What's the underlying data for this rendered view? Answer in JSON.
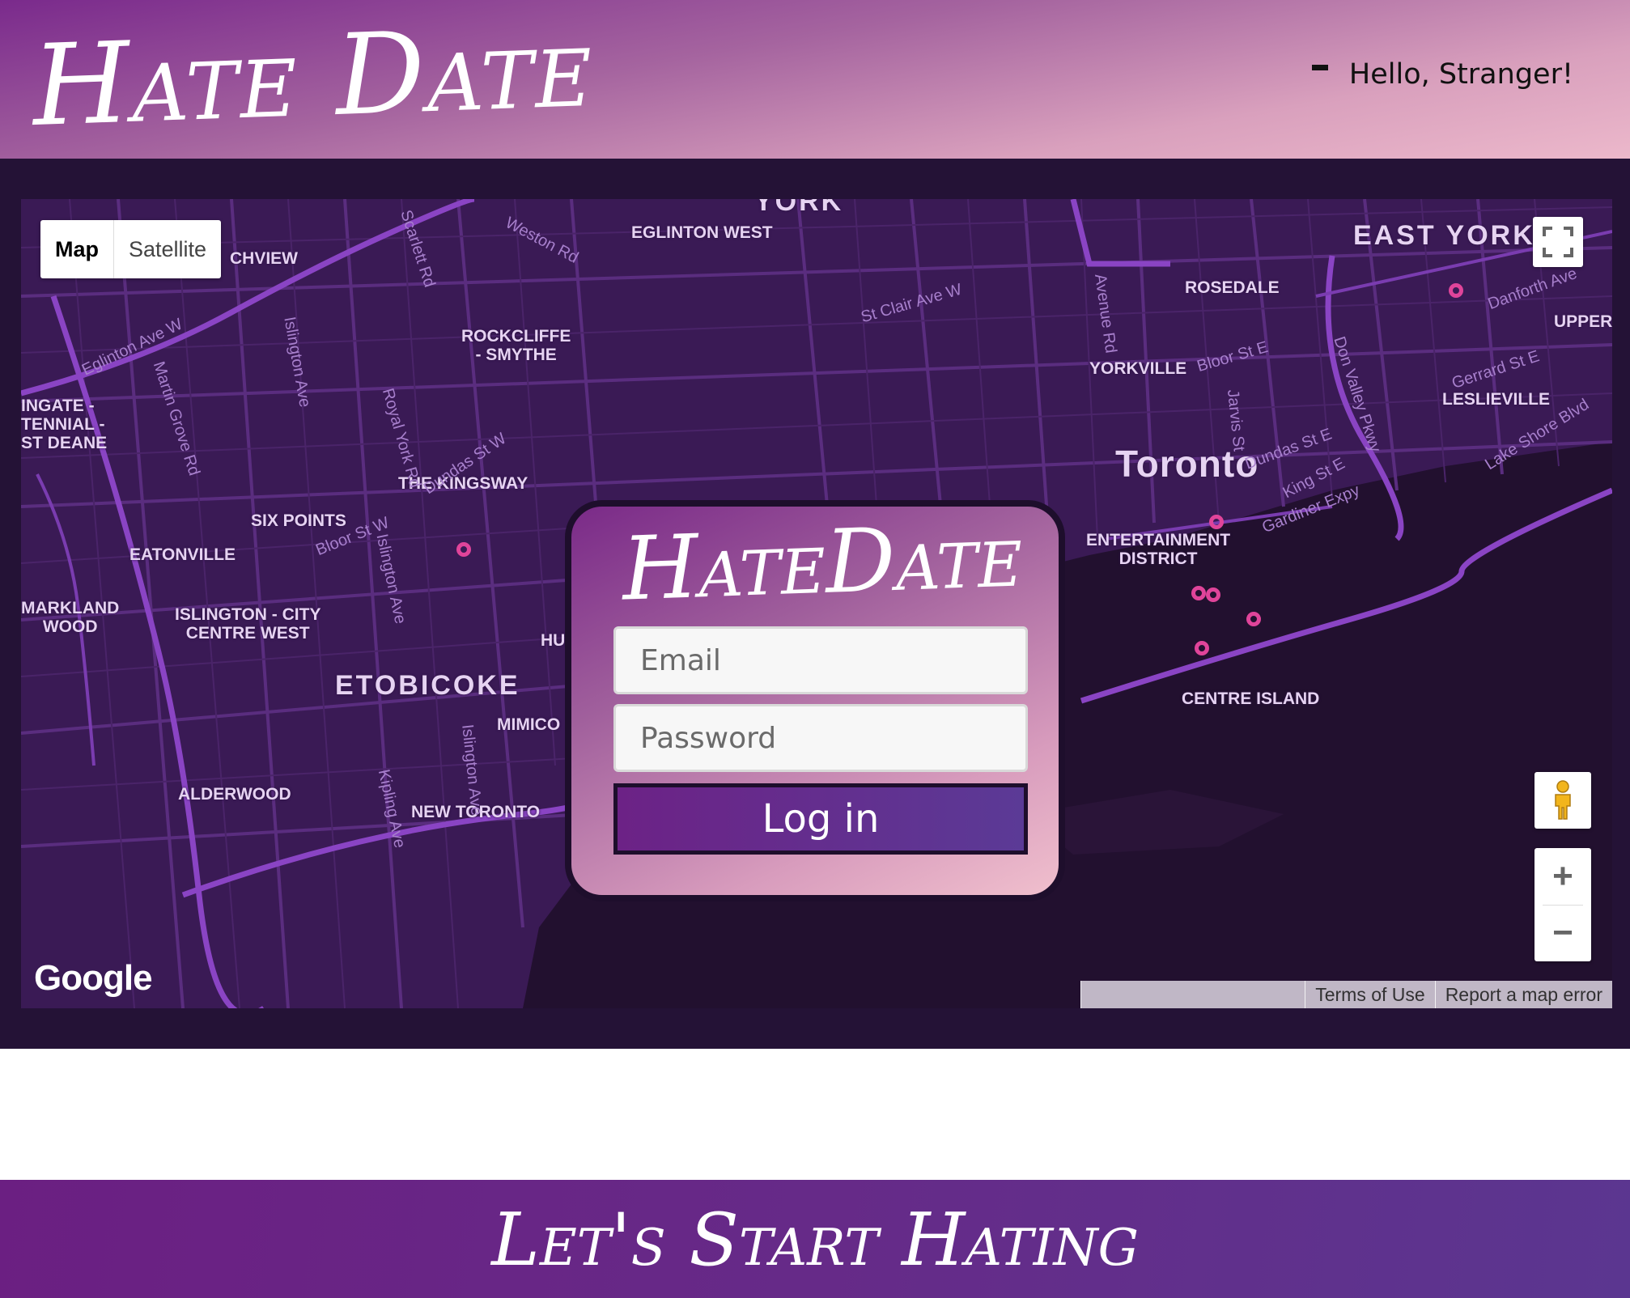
{
  "header": {
    "brand": "Hate Date",
    "greeting": "Hello, Stranger!"
  },
  "map": {
    "type_controls": {
      "map": "Map",
      "satellite": "Satellite"
    },
    "labels": {
      "york": "YORK",
      "eglinton_west": "EGLINTON WEST",
      "east_york": "EAST YORK",
      "rosedale": "ROSEDALE",
      "upper": "UPPER",
      "yorkville": "YORKVILLE",
      "leslieville": "LESLIEVILLE",
      "toronto": "Toronto",
      "entertainment_district": "ENTERTAINMENT\nDISTRICT",
      "centre_island": "CENTRE ISLAND",
      "rockcliffe": "ROCKCLIFFE\n- SMYTHE",
      "the_kingsway": "THE KINGSWAY",
      "six_points": "SIX POINTS",
      "eatonville": "EATONVILLE",
      "islington": "ISLINGTON - CITY\nCENTRE WEST",
      "humber_bay": "HUMBER BAY",
      "etobicoke": "ETOBICOKE",
      "mimico": "MIMICO",
      "alderwood": "ALDERWOOD",
      "new_toronto": "NEW TORONTO",
      "markland": "MARKLAND\nWOOD",
      "kingsview": "CHVIEW",
      "thistletown": "INGATE -\nTENNIAL -\nST DEANE"
    },
    "streets": {
      "weston": "Weston Rd",
      "scarlett": "Scarlett Rd",
      "st_clair": "St Clair Ave W",
      "avenue_rd": "Avenue Rd",
      "bloor_e": "Bloor St E",
      "jarvis": "Jarvis St",
      "dvp": "Don Valley Pkwy",
      "danforth": "Danforth Ave",
      "gerrard": "Gerrard St E",
      "dundas_e": "Dundas St E",
      "king_e": "King St E",
      "gardiner": "Gardiner Expy",
      "lakeshore": "Lake Shore Blvd",
      "eglinton_w": "Eglinton Ave W",
      "martin_grove": "Martin Grove Rd",
      "islington_ave": "Islington Ave",
      "royal_york": "Royal York Rd",
      "dundas_w": "Dundas St W",
      "bloor_w": "Bloor St W",
      "kipling": "Kipling Ave",
      "islington_ave2": "Islington Ave",
      "islington_ave3": "Islington Ave"
    },
    "google_logo": "Google",
    "attribution": {
      "terms": "Terms of Use",
      "report": "Report a map error"
    },
    "zoom": {
      "in": "+",
      "out": "−"
    }
  },
  "login": {
    "title": "HateDate",
    "email_placeholder": "Email",
    "password_placeholder": "Password",
    "button": "Log in"
  },
  "footer": {
    "cta": "Let's Start Hating"
  },
  "colors": {
    "accent": "#6c2286",
    "map_bg": "#3a1a55",
    "pin": "#e0449a"
  }
}
